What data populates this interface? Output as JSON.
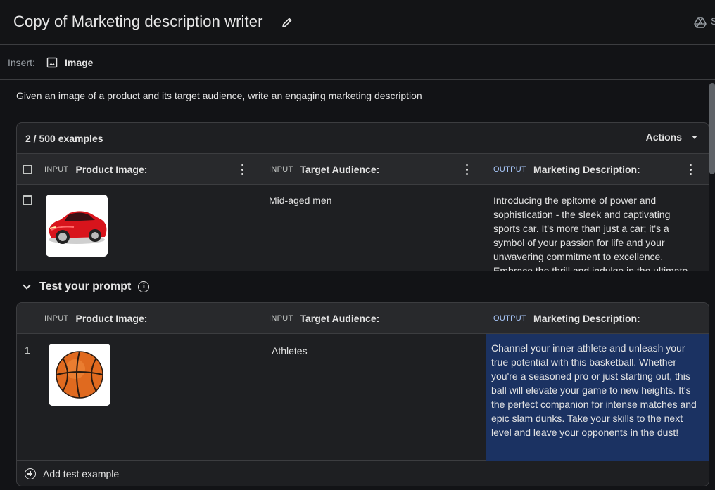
{
  "header": {
    "title": "Copy of Marketing description writer",
    "edit_icon": "pencil-icon",
    "drive_icon": "drive-icon",
    "truncated_action": "S"
  },
  "insert_bar": {
    "label": "Insert:",
    "image_button": "Image",
    "image_icon": "image-icon"
  },
  "instructions": "Given an image of a product and its target audience, write an engaging marketing description",
  "examples": {
    "count": "2 / 500 examples",
    "actions_label": "Actions",
    "columns": [
      {
        "tag": "INPUT",
        "name": "Product Image:"
      },
      {
        "tag": "INPUT",
        "name": "Target Audience:"
      },
      {
        "tag": "OUTPUT",
        "name": "Marketing Description:"
      }
    ],
    "rows": [
      {
        "image": "red sports car",
        "audience": "Mid-aged men",
        "description": "Introducing the epitome of power and sophistication - the sleek and captivating sports car. It's more than just a car; it's a symbol of your passion for life and your unwavering commitment to excellence. Embrace the thrill and indulge in the ultimate"
      }
    ]
  },
  "test": {
    "heading": "Test your prompt",
    "columns": [
      {
        "tag": "INPUT",
        "name": "Product Image:"
      },
      {
        "tag": "INPUT",
        "name": "Target Audience:"
      },
      {
        "tag": "OUTPUT",
        "name": "Marketing Description:"
      }
    ],
    "rows": [
      {
        "number": "1",
        "image": "basketball",
        "audience": "Athletes",
        "description": "Channel your inner athlete and unleash your true potential with this basketball. Whether you're a seasoned pro or just starting out, this ball will elevate your game to new heights. It's the perfect companion for intense matches and epic slam dunks. Take your skills to the next level and leave your opponents in the dust!"
      }
    ],
    "add_label": "Add test example"
  },
  "colors": {
    "background": "#121316",
    "panel": "#1e1f22",
    "header_row": "#28292c",
    "output_highlight": "#1b3262",
    "output_tag": "#a8c7fa"
  }
}
